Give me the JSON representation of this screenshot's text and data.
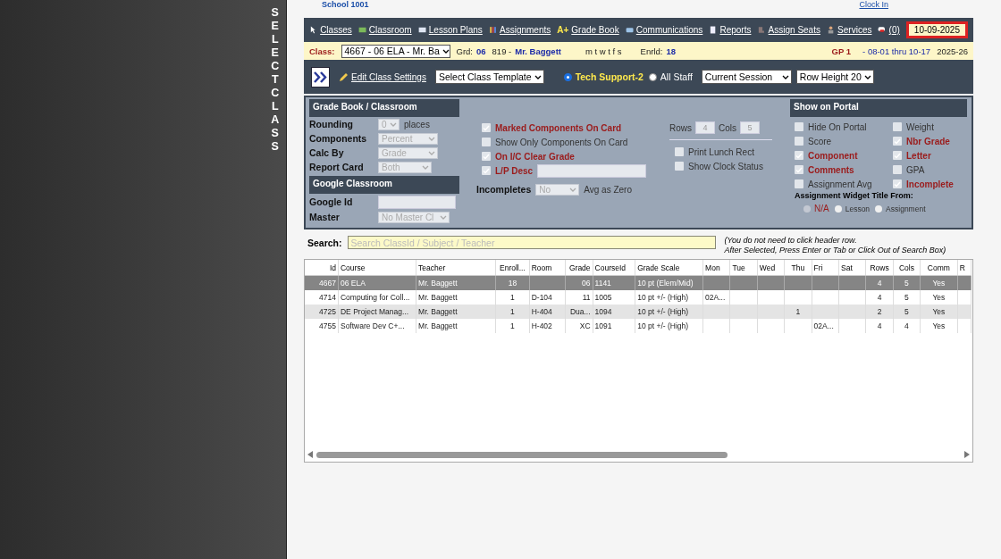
{
  "side_label": "SELECT CLASS",
  "top_strip": {
    "school": "School 1001",
    "clock": "Clock In"
  },
  "nav": {
    "links": [
      {
        "label": "Classes"
      },
      {
        "label": "Classroom"
      },
      {
        "label": "Lesson Plans"
      },
      {
        "label": "Assignments"
      },
      {
        "label": "Grade Book",
        "mark": "A+"
      },
      {
        "label": "Communications"
      },
      {
        "label": "Reports"
      },
      {
        "label": "Assign Seats"
      },
      {
        "label": "Services"
      },
      {
        "label": "(0)"
      }
    ],
    "date": "10-09-2025"
  },
  "class_bar": {
    "label": "Class:",
    "class_value": "4667 - 06 ELA - Mr. Ba",
    "grd_label": "Grd:",
    "grd": "06",
    "teacher_id": "819 -",
    "teacher": "Mr. Baggett",
    "days": "m t w t f s",
    "enrld_label": "Enrld:",
    "enrld": "18",
    "gp": "GP 1",
    "gp_range": "- 08-01 thru 10-17",
    "year": "2025-26"
  },
  "toolbar": {
    "edit": "Edit Class Settings",
    "template": "Select Class Template",
    "radios": [
      {
        "label": "Tech Support-2",
        "selected": true
      },
      {
        "label": "All Staff",
        "selected": false
      }
    ],
    "session": "Current Session",
    "row_height": "Row Height 20"
  },
  "gradebook": {
    "title": "Grade Book / Classroom",
    "fields": [
      {
        "label": "Rounding",
        "value": "0",
        "suffix": "places"
      },
      {
        "label": "Components",
        "value": "Percent"
      },
      {
        "label": "Calc By",
        "value": "Grade"
      },
      {
        "label": "Report Card",
        "value": "Both"
      }
    ],
    "google": {
      "title": "Google Classroom",
      "id_label": "Google Id",
      "master_label": "Master",
      "master_value": "No Master Cl"
    },
    "options": [
      {
        "label": "Marked Components On Card",
        "checked": true
      },
      {
        "label": "Show Only Components On Card",
        "checked": false
      },
      {
        "label": "On I/C Clear Grade",
        "checked": true
      },
      {
        "label": "L/P Desc",
        "checked": true
      }
    ],
    "incompletes": {
      "label": "Incompletes",
      "value": "No",
      "suffix": "Avg as Zero"
    },
    "rows_label": "Rows",
    "rows": "4",
    "cols_label": "Cols",
    "cols": "5",
    "extras": [
      {
        "label": "Print Lunch Rect",
        "checked": false
      },
      {
        "label": "Show Clock Status",
        "checked": false
      }
    ]
  },
  "portal": {
    "title": "Show on Portal",
    "options": [
      {
        "label": "Hide On Portal",
        "checked": false
      },
      {
        "label": "Weight",
        "checked": false
      },
      {
        "label": "Score",
        "checked": false
      },
      {
        "label": "Nbr Grade",
        "checked": true
      },
      {
        "label": "Component",
        "checked": true
      },
      {
        "label": "Letter",
        "checked": true
      },
      {
        "label": "Comments",
        "checked": true
      },
      {
        "label": "GPA",
        "checked": false
      },
      {
        "label": "Assignment Avg",
        "checked": false
      },
      {
        "label": "Incomplete",
        "checked": true
      }
    ],
    "widget_title": "Assignment Widget Title From:",
    "widget_options": [
      {
        "label": "N/A",
        "selected": true
      },
      {
        "label": "Lesson",
        "selected": false
      },
      {
        "label": "Assignment",
        "selected": false
      }
    ]
  },
  "search": {
    "label": "Search:",
    "placeholder": "Search ClassId / Subject / Teacher",
    "hint_1": "(You do not need to click header row.",
    "hint_2": "After Selected, Press Enter or Tab or Click Out of Search Box)"
  },
  "table": {
    "columns": [
      "Id",
      "Course",
      "Teacher",
      "Enroll...",
      "Room",
      "Grade",
      "CourseId",
      "Grade Scale",
      "Mon",
      "Tue",
      "Wed",
      "Thu",
      "Fri",
      "Sat",
      "Rows",
      "Cols",
      "Comm",
      "R"
    ],
    "rows": [
      {
        "selected": true,
        "cells": [
          "4667",
          "06 ELA",
          "Mr. Baggett",
          "18",
          "",
          "06",
          "1141",
          "10 pt (Elem/Mid)",
          "",
          "",
          "",
          "",
          "",
          "",
          "4",
          "5",
          "Yes",
          ""
        ]
      },
      {
        "selected": false,
        "cells": [
          "4714",
          "Computing for Coll...",
          "Mr. Baggett",
          "1",
          "D-104",
          "11",
          "1005",
          "10 pt +/- (High)",
          "02A...",
          "",
          "",
          "",
          "",
          "",
          "4",
          "5",
          "Yes",
          ""
        ]
      },
      {
        "selected": false,
        "cells": [
          "4725",
          "DE Project Manag...",
          "Mr. Baggett",
          "1",
          "H-404",
          "Dua...",
          "1094",
          "10 pt +/- (High)",
          "",
          "",
          "",
          "1",
          "",
          "",
          "2",
          "5",
          "Yes",
          ""
        ]
      },
      {
        "selected": false,
        "cells": [
          "4755",
          "Software Dev C+...",
          "Mr. Baggett",
          "1",
          "H-402",
          "XC",
          "1091",
          "10 pt +/- (High)",
          "",
          "",
          "",
          "",
          "02A...",
          "",
          "4",
          "4",
          "Yes",
          ""
        ]
      }
    ]
  }
}
